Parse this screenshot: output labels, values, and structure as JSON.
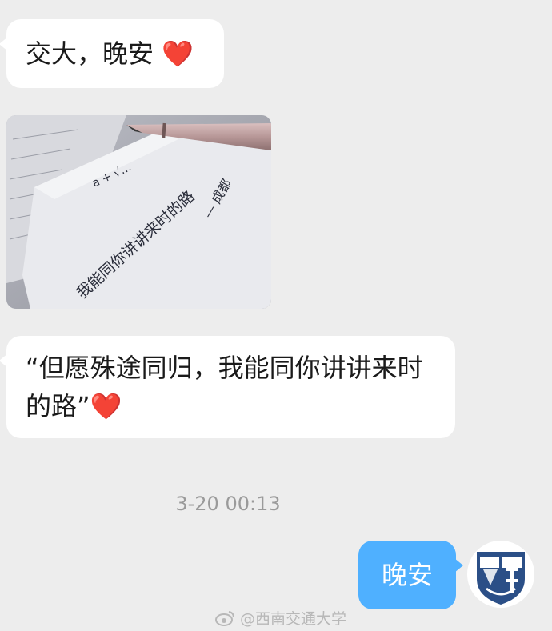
{
  "messages": {
    "first": {
      "text": "交大，晚安",
      "emoji": "❤️"
    },
    "photo": {
      "handwriting_line1": "我能同你讲讲来时的路",
      "handwriting_signed": "— 成都",
      "equation_fragment": "a + √…"
    },
    "quote": {
      "text": "“但愿殊途同归，我能同你讲讲来时的路”",
      "emoji": "❤️"
    },
    "timestamp": "3-20 00:13",
    "reply": {
      "text": "晚安"
    }
  },
  "watermark": "@西南交通大学",
  "colors": {
    "background": "#ededed",
    "incoming_bubble": "#ffffff",
    "outgoing_bubble": "#4fb0ff",
    "heart": "#e0242a",
    "avatar_blue": "#2b4f87"
  },
  "icons": {
    "heart": "red-heart-emoji",
    "avatar": "university-emblem",
    "watermark": "weibo-logo"
  }
}
